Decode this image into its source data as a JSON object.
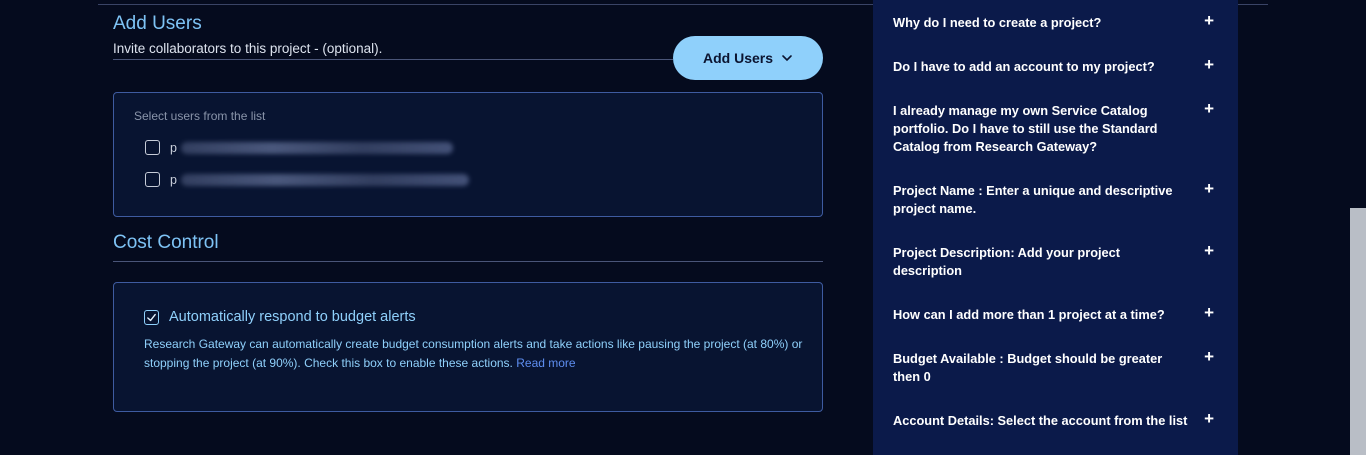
{
  "add_users": {
    "title": "Add Users",
    "subtitle": "Invite collaborators to this project - (optional).",
    "button_label": "Add Users",
    "list_label": "Select users from the list",
    "users": [
      {
        "prefix": "p"
      },
      {
        "prefix": "p"
      }
    ]
  },
  "cost_control": {
    "title": "Cost Control",
    "checkbox_label": "Automatically respond to budget alerts",
    "checked": true,
    "description": "Research Gateway can automatically create budget consumption alerts and take actions like pausing the project (at 80%) or stopping the project (at 90%). Check this box to enable these actions.",
    "read_more": "Read more"
  },
  "faq": {
    "items": [
      {
        "question": "Why do I need to create a project?",
        "icon": "plus-icon"
      },
      {
        "question": "Do I have to add an account to my project?",
        "icon": "plus-icon"
      },
      {
        "question": "I already manage my own Service Catalog portfolio. Do I have to still use the Standard Catalog from Research Gateway?",
        "icon": "plus-icon"
      },
      {
        "question": "Project Name : Enter a unique and descriptive project name.",
        "icon": "plus-icon"
      },
      {
        "question": "Project Description: Add your project description",
        "icon": "plus-icon"
      },
      {
        "question": "How can I add more than 1 project at a time?",
        "icon": "plus-icon"
      },
      {
        "question": "Budget Available : Budget should be greater then 0",
        "icon": "plus-icon"
      },
      {
        "question": "Account Details: Select the account from the list",
        "icon": "plus-icon"
      }
    ],
    "plus_symbol": "+"
  },
  "colors": {
    "background": "#050b1e",
    "accent": "#8fd0fb",
    "faq_panel": "#0b1a4a",
    "link": "#5e8ef0"
  }
}
